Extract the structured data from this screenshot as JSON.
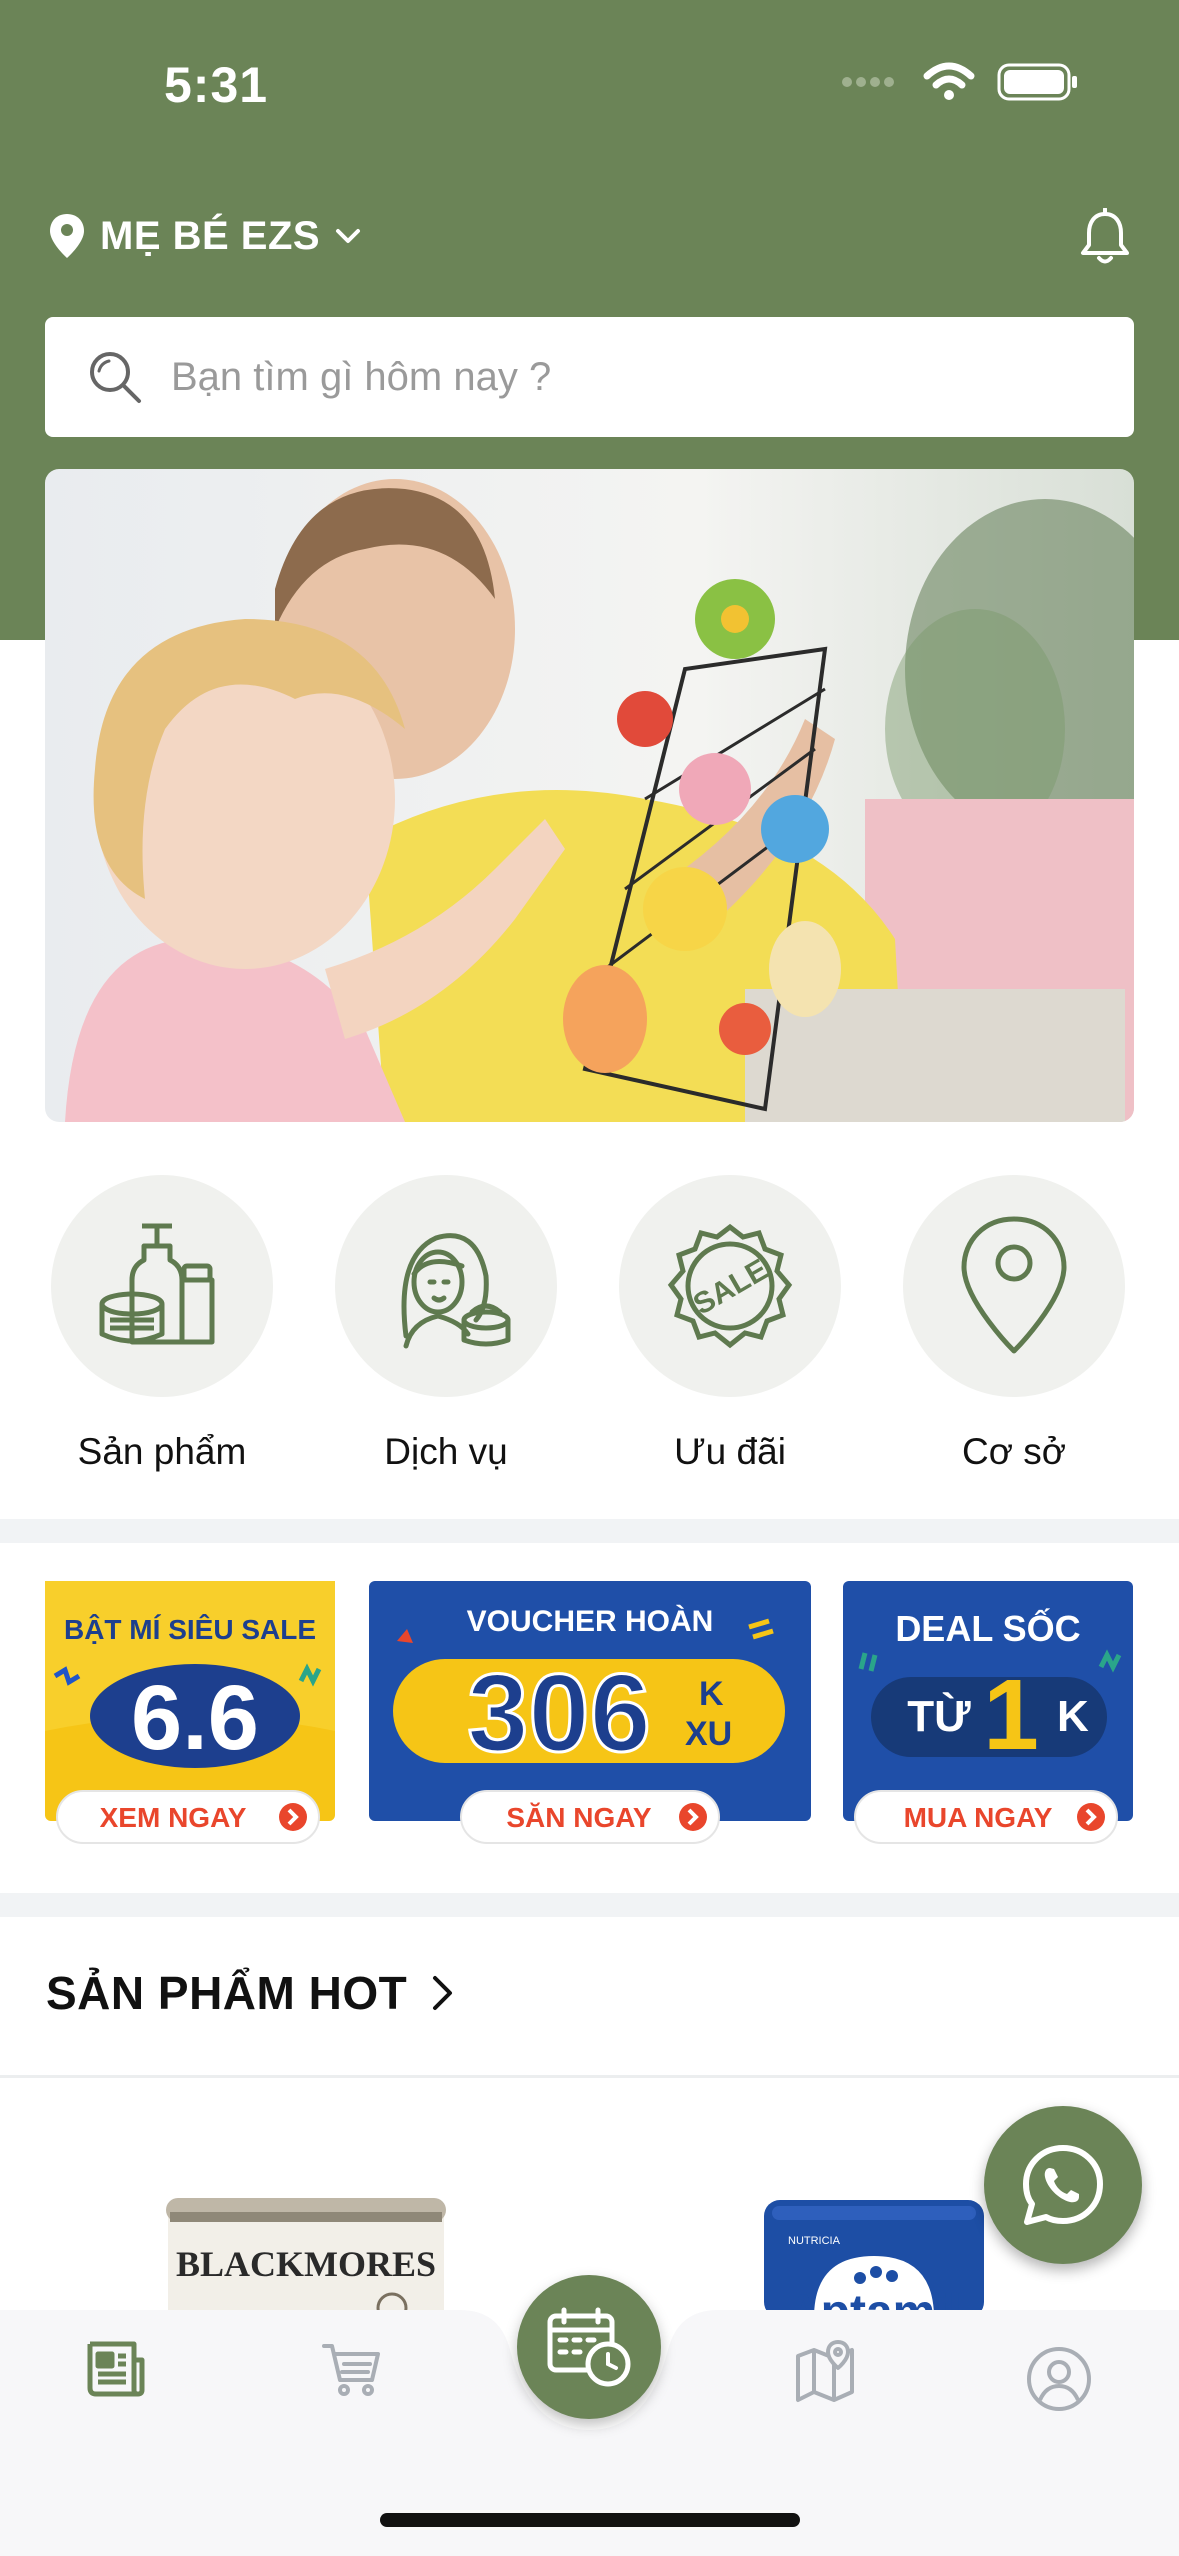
{
  "status_bar": {
    "time": "5:31"
  },
  "header": {
    "location_name": "MẸ BÉ EZS",
    "search_placeholder": "Bạn tìm gì hôm nay ?"
  },
  "colors": {
    "brand": "#6b8457",
    "brand_dark": "#5c7449",
    "promo_blue": "#1f4fa8",
    "promo_yellow": "#f6c516",
    "promo_red": "#e9462c"
  },
  "categories": [
    {
      "label": "Sản phẩm",
      "icon": "cosmetics-bottles-icon"
    },
    {
      "label": "Dịch vụ",
      "icon": "woman-face-cream-icon"
    },
    {
      "label": "Ưu đãi",
      "icon": "sale-badge-icon"
    },
    {
      "label": "Cơ sở",
      "icon": "map-pin-icon"
    }
  ],
  "promos": [
    {
      "top": "BẬT MÍ SIÊU SALE",
      "big": "6.6",
      "button": "XEM NGAY"
    },
    {
      "top": "VOUCHER HOÀN",
      "big": "306",
      "suffix1": "K",
      "suffix2": "XU",
      "button": "SĂN NGAY"
    },
    {
      "top": "DEAL SỐC",
      "prefix": "TỪ",
      "big": "1",
      "suffix": "K",
      "button": "MUA NGAY"
    }
  ],
  "hot_section": {
    "title": "SẢN PHẨM HOT"
  },
  "products": [
    {
      "brand_text": "BLACKMORES"
    },
    {
      "brand_text": "Aptamil",
      "maker_text": "NUTRICIA"
    }
  ],
  "bottom_nav": {
    "items": [
      "news-icon",
      "cart-icon",
      "calendar-clock-icon",
      "map-icon",
      "profile-icon"
    ]
  }
}
